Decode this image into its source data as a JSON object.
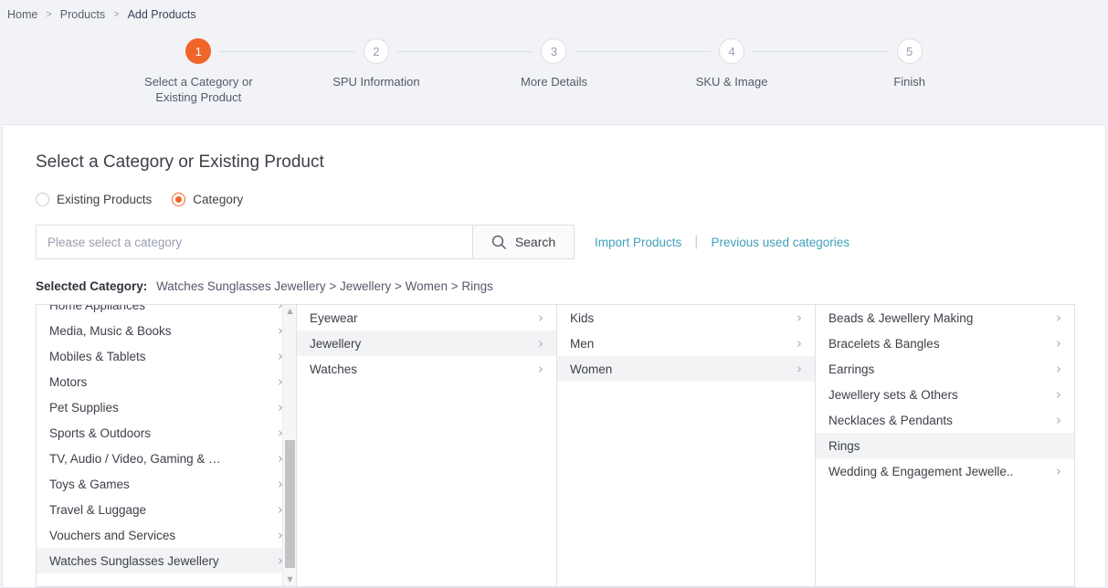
{
  "breadcrumb": [
    {
      "label": "Home",
      "current": false
    },
    {
      "label": "Products",
      "current": false
    },
    {
      "label": "Add Products",
      "current": true
    }
  ],
  "stepper": {
    "steps": [
      {
        "num": "1",
        "label": "Select a Category or Existing Product",
        "active": true
      },
      {
        "num": "2",
        "label": "SPU Information",
        "active": false
      },
      {
        "num": "3",
        "label": "More Details",
        "active": false
      },
      {
        "num": "4",
        "label": "SKU & Image",
        "active": false
      },
      {
        "num": "5",
        "label": "Finish",
        "active": false
      }
    ],
    "active_color": "#f0652a",
    "inactive_color": "#9a9db0"
  },
  "card": {
    "title": "Select a Category or Existing Product",
    "radios": [
      {
        "label": "Existing Products",
        "selected": false
      },
      {
        "label": "Category",
        "selected": true
      }
    ],
    "search": {
      "placeholder": "Please select a category",
      "value": "",
      "button_label": "Search",
      "button_icon": "search-icon"
    },
    "links": [
      {
        "label": "Import Products"
      },
      {
        "label": "Previous used categories"
      }
    ],
    "link_separator": "|",
    "link_color": "#3fa0bd",
    "selected_category": {
      "label": "Selected Category:",
      "value": "Watches Sunglasses Jewellery > Jewellery > Women > Rings"
    }
  },
  "category_columns": [
    {
      "name": "level-1",
      "scrollable": true,
      "clipped_top": true,
      "items": [
        {
          "label": "Home Appliances",
          "chevron": true,
          "selected": false
        },
        {
          "label": "Media, Music & Books",
          "chevron": true,
          "selected": false
        },
        {
          "label": "Mobiles & Tablets",
          "chevron": true,
          "selected": false
        },
        {
          "label": "Motors",
          "chevron": true,
          "selected": false
        },
        {
          "label": "Pet Supplies",
          "chevron": true,
          "selected": false
        },
        {
          "label": "Sports & Outdoors",
          "chevron": true,
          "selected": false
        },
        {
          "label": "TV, Audio / Video, Gaming & …",
          "chevron": true,
          "selected": false
        },
        {
          "label": "Toys & Games",
          "chevron": true,
          "selected": false
        },
        {
          "label": "Travel & Luggage",
          "chevron": true,
          "selected": false
        },
        {
          "label": "Vouchers and Services",
          "chevron": true,
          "selected": false
        },
        {
          "label": "Watches Sunglasses Jewellery",
          "chevron": true,
          "selected": true
        }
      ]
    },
    {
      "name": "level-2",
      "scrollable": false,
      "clipped_top": false,
      "items": [
        {
          "label": "Eyewear",
          "chevron": true,
          "selected": false
        },
        {
          "label": "Jewellery",
          "chevron": true,
          "selected": true
        },
        {
          "label": "Watches",
          "chevron": true,
          "selected": false
        }
      ]
    },
    {
      "name": "level-3",
      "scrollable": false,
      "clipped_top": false,
      "items": [
        {
          "label": "Kids",
          "chevron": true,
          "selected": false
        },
        {
          "label": "Men",
          "chevron": true,
          "selected": false
        },
        {
          "label": "Women",
          "chevron": true,
          "selected": true
        }
      ]
    },
    {
      "name": "level-4",
      "scrollable": false,
      "clipped_top": false,
      "items": [
        {
          "label": "Beads & Jewellery Making",
          "chevron": true,
          "selected": false
        },
        {
          "label": "Bracelets & Bangles",
          "chevron": true,
          "selected": false
        },
        {
          "label": "Earrings",
          "chevron": true,
          "selected": false
        },
        {
          "label": "Jewellery sets & Others",
          "chevron": true,
          "selected": false
        },
        {
          "label": "Necklaces & Pendants",
          "chevron": true,
          "selected": false
        },
        {
          "label": "Rings",
          "chevron": false,
          "selected": true
        },
        {
          "label": "Wedding & Engagement Jewelle..",
          "chevron": true,
          "selected": false
        }
      ]
    }
  ]
}
